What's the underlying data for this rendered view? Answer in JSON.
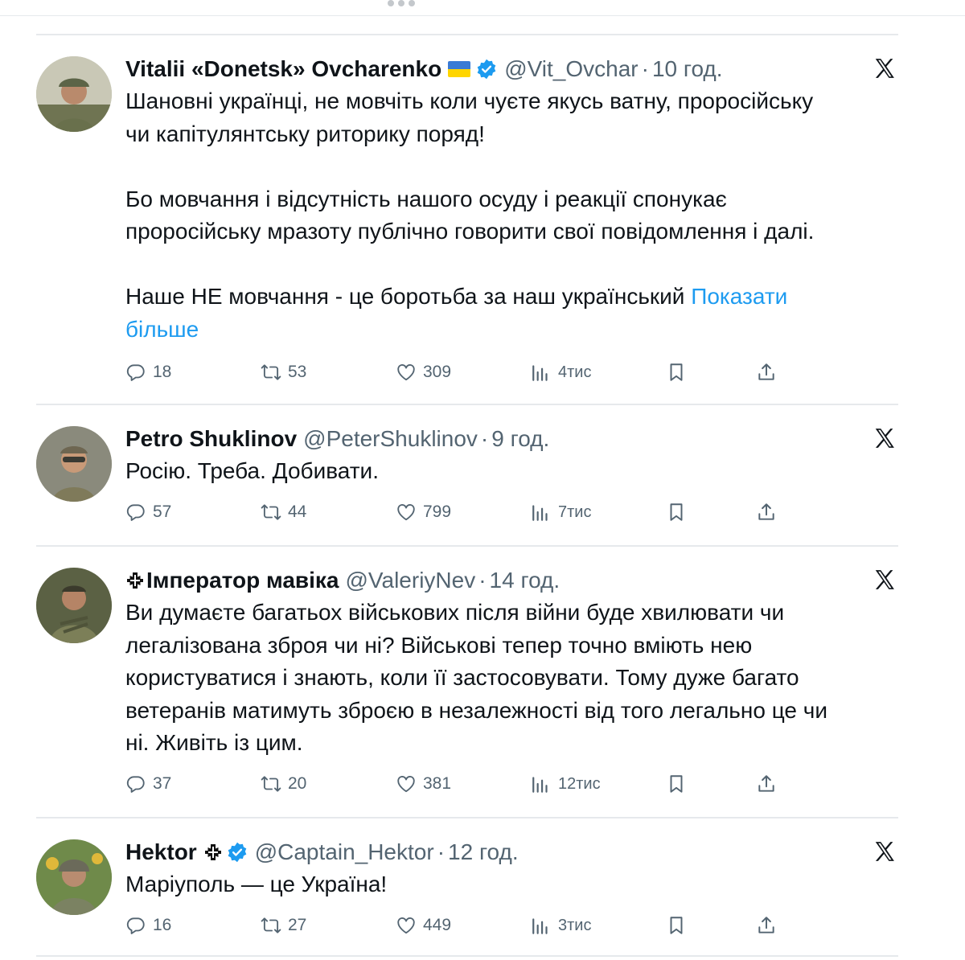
{
  "tweets": [
    {
      "name": "Vitalii «Donetsk» Ovcharenko",
      "handle": "@Vit_Ovchar",
      "time": "10 год.",
      "paragraphs": [
        [
          "Шановні українці, не мовчіть коли чуєте якусь ватну, проросійську",
          "чи капітулянтську риторику поряд!"
        ],
        [
          "Бо мовчання і відсутність нашого осуду і реакції  спонукає",
          "проросійську мразоту публічно говорити свої повідомлення і далі."
        ],
        [
          "Наше НЕ мовчання - це боротьба за наш український"
        ]
      ],
      "show_more": [
        "Показати",
        "більше"
      ],
      "stats": {
        "replies": "18",
        "reposts": "53",
        "likes": "309",
        "views": "4тис"
      }
    },
    {
      "name": "Petro Shuklinov",
      "handle": "@PeterShuklinov",
      "time": "9 год.",
      "text": "Росію. Треба. Добивати.",
      "stats": {
        "replies": "57",
        "reposts": "44",
        "likes": "799",
        "views": "7тис"
      }
    },
    {
      "name": "Імператор мавіка",
      "handle": "@ValeriyNev",
      "time": "14 год.",
      "lines": [
        "Ви думаєте багатьох військових після війни буде хвилювати чи",
        "легалізована зброя чи ні? Військові тепер точно вміють нею",
        "користуватися і знають, коли її застосовувати. Тому дуже багато",
        "ветеранів матимуть зброєю в незалежності від того легально це чи",
        "ні. Живіть із цим."
      ],
      "stats": {
        "replies": "37",
        "reposts": "20",
        "likes": "381",
        "views": "12тис"
      }
    },
    {
      "name": "Hektor",
      "handle": "@Captain_Hektor",
      "time": "12 год.",
      "text": "Маріуполь — це Україна!",
      "stats": {
        "replies": "16",
        "reposts": "27",
        "likes": "449",
        "views": "3тис"
      }
    }
  ],
  "colors": {
    "accent": "#1d9bf0",
    "muted": "#536471",
    "text": "#0f1419",
    "divider": "#e6e9ec"
  },
  "icons": [
    "reply-icon",
    "repost-icon",
    "like-icon",
    "views-icon",
    "bookmark-icon",
    "share-icon",
    "x-logo-icon",
    "verified-badge-icon",
    "ukraine-flag-icon",
    "cross-icon"
  ]
}
